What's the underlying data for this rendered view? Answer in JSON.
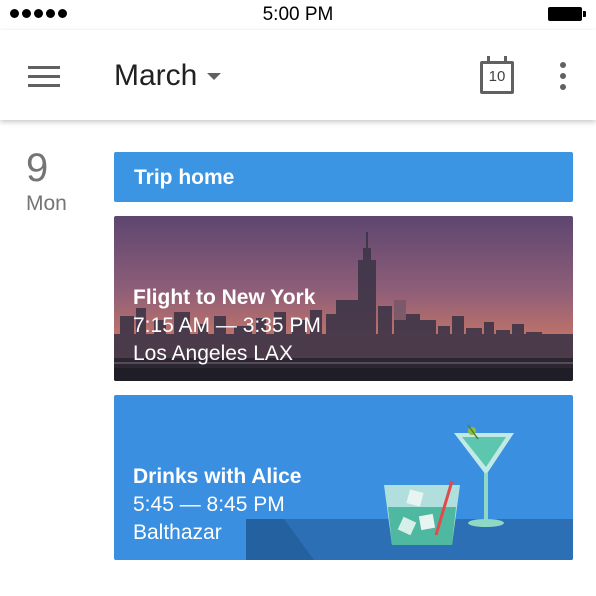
{
  "status_bar": {
    "time": "5:00 PM"
  },
  "app_bar": {
    "month": "March",
    "today_date": "10"
  },
  "day": {
    "number": "9",
    "name": "Mon"
  },
  "events": {
    "trip": {
      "title": "Trip home"
    },
    "flight": {
      "title": "Flight to New York",
      "time": "7:15 AM — 3:35 PM",
      "location": "Los Angeles LAX"
    },
    "drinks": {
      "title": "Drinks with Alice",
      "time": "5:45 — 8:45 PM",
      "location": "Balthazar"
    }
  },
  "colors": {
    "accent": "#3b95e3",
    "drinks_bg": "#3a8fe0",
    "text_secondary": "#757575"
  },
  "icons": [
    "signal-dots-icon",
    "battery-icon",
    "menu-icon",
    "chevron-down-icon",
    "today-calendar-icon",
    "more-vert-icon",
    "cocktail-glass-icon",
    "martini-glass-icon"
  ]
}
